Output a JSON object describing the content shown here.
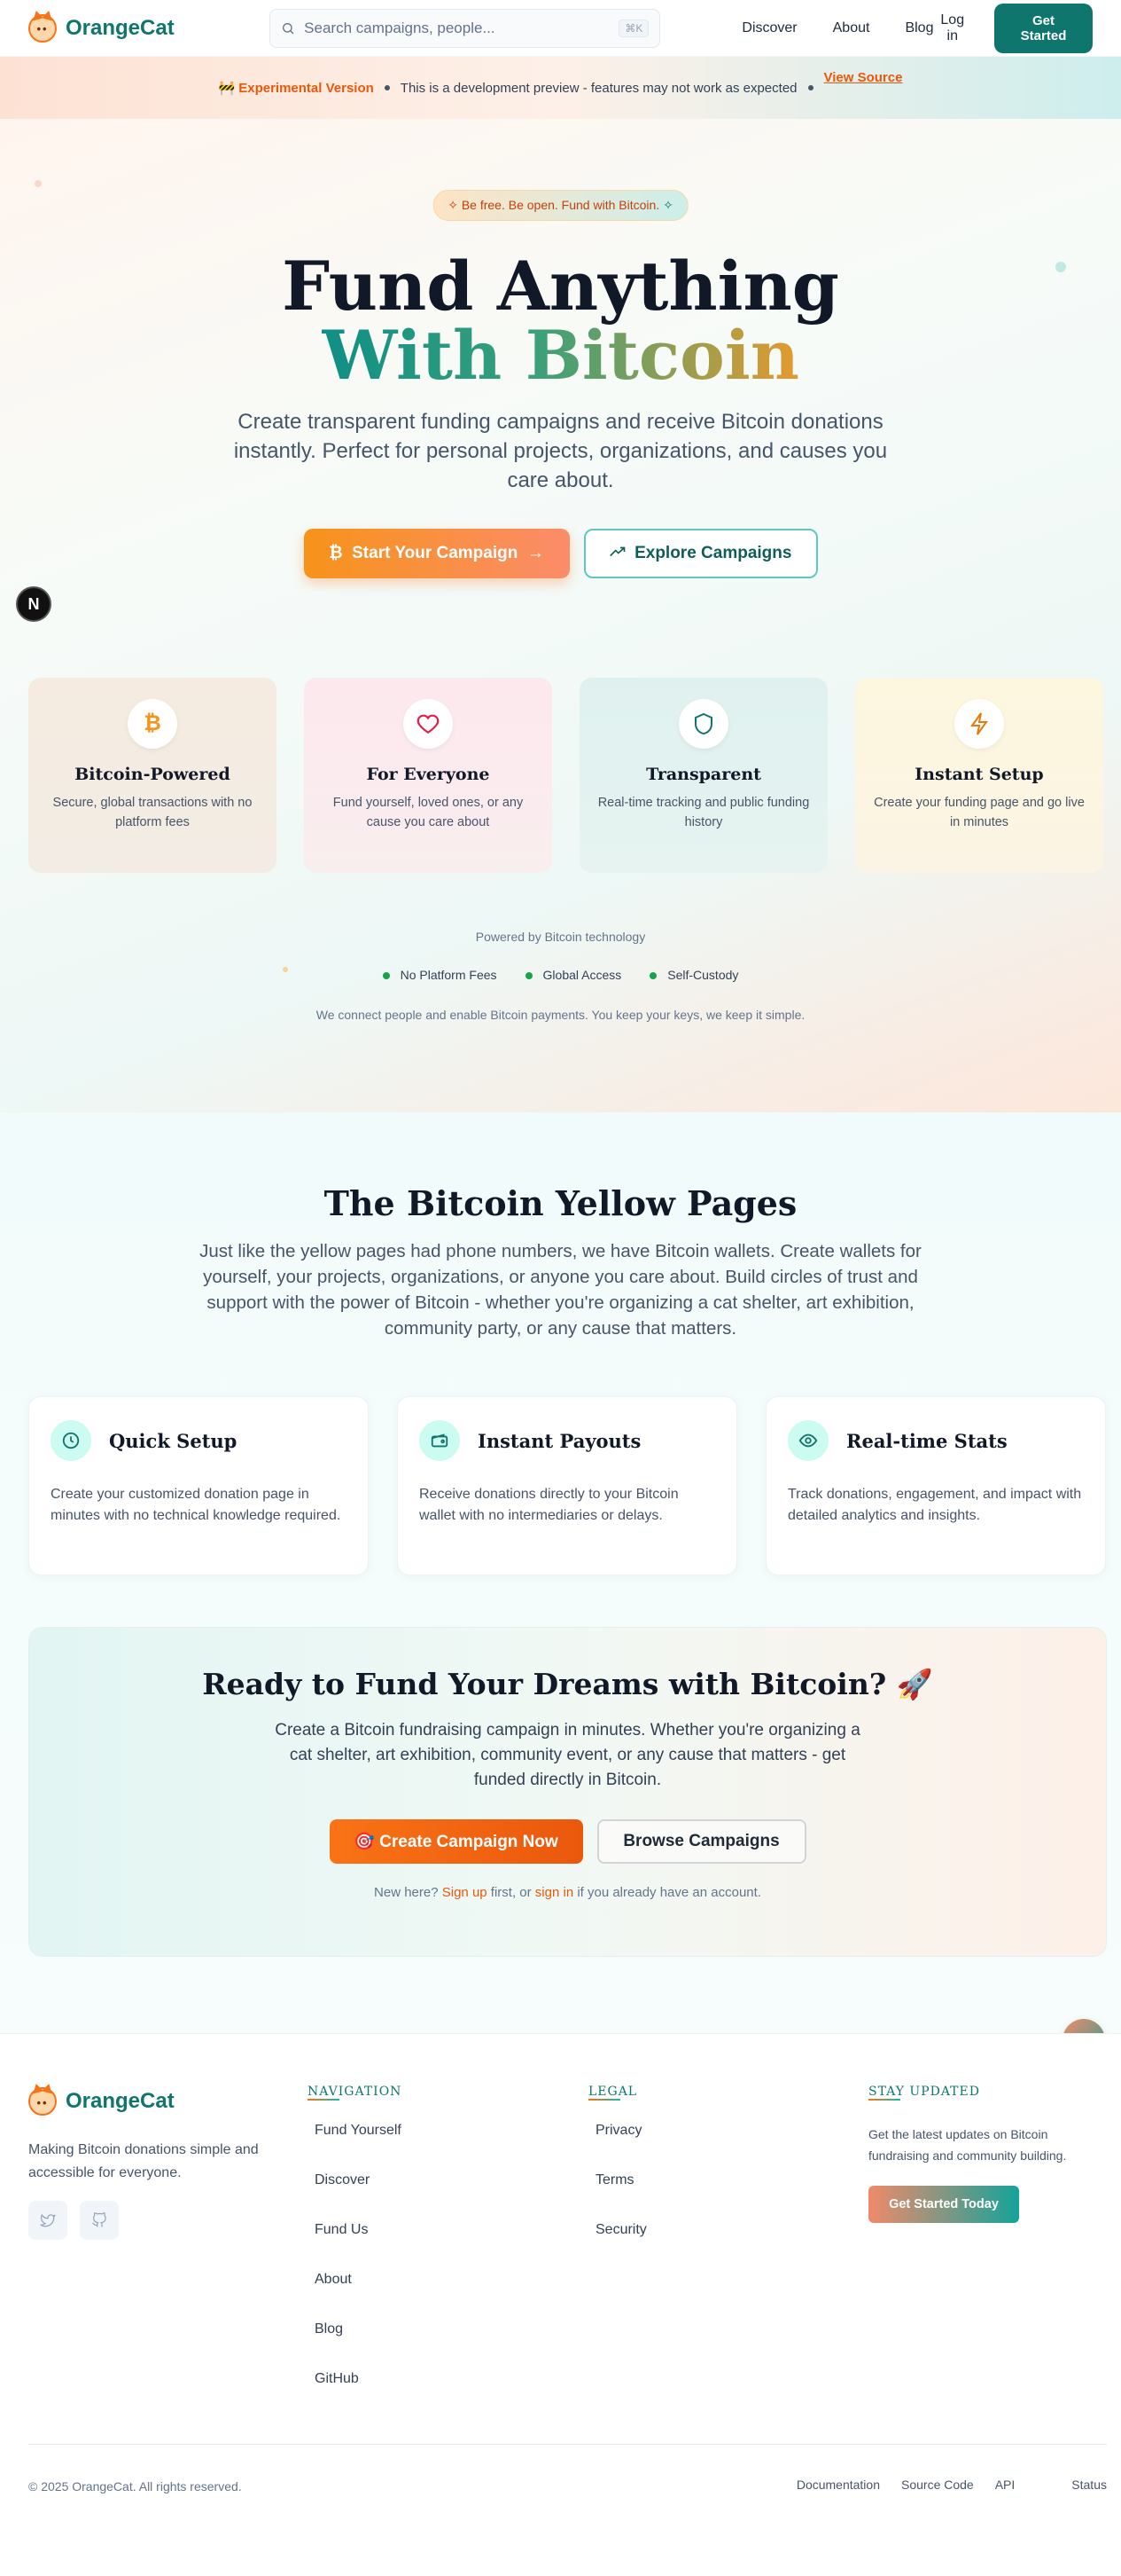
{
  "header": {
    "brand": "OrangeCat",
    "search_placeholder": "Search campaigns, people...",
    "shortcut": "⌘K",
    "nav": [
      "Discover",
      "About",
      "Blog"
    ],
    "login": "Log in",
    "cta": "Get Started"
  },
  "banner": {
    "icon": "🚧",
    "label": "Experimental Version",
    "message": "This is a development preview - features may not work as expected",
    "link": "View Source"
  },
  "hero": {
    "pill": "Be free. Be open. Fund with Bitcoin.",
    "title_line1": "Fund Anything",
    "title_line2": "With Bitcoin",
    "lead": "Create transparent funding campaigns and receive Bitcoin donations instantly. Perfect for personal projects, organizations, and causes you care about.",
    "primary_button": "Start Your Campaign",
    "secondary_button": "Explore Campaigns",
    "badge": "N",
    "features": [
      {
        "title": "Bitcoin-Powered",
        "desc": "Secure, global transactions with no platform fees",
        "icon": "bitcoin-icon"
      },
      {
        "title": "For Everyone",
        "desc": "Fund yourself, loved ones, or any cause you care about",
        "icon": "heart-icon"
      },
      {
        "title": "Transparent",
        "desc": "Real-time tracking and public funding history",
        "icon": "shield-icon"
      },
      {
        "title": "Instant Setup",
        "desc": "Create your funding page and go live in minutes",
        "icon": "lightning-icon"
      }
    ],
    "powered": "Powered by Bitcoin technology",
    "bullets": [
      "No Platform Fees",
      "Global Access",
      "Self-Custody"
    ],
    "tagline": "We connect people and enable Bitcoin payments. You keep your keys, we keep it simple."
  },
  "yellow": {
    "title": "The Bitcoin Yellow Pages",
    "intro": "Just like the yellow pages had phone numbers, we have Bitcoin wallets. Create wallets for yourself, your projects, organizations, or anyone you care about. Build circles of trust and support with the power of Bitcoin - whether you're organizing a cat shelter, art exhibition, community party, or any cause that matters.",
    "cards": [
      {
        "title": "Quick Setup",
        "desc": "Create your customized donation page in minutes with no technical knowledge required.",
        "icon": "clock-icon"
      },
      {
        "title": "Instant Payouts",
        "desc": "Receive donations directly to your Bitcoin wallet with no intermediaries or delays.",
        "icon": "wallet-icon"
      },
      {
        "title": "Real-time Stats",
        "desc": "Track donations, engagement, and impact with detailed analytics and insights.",
        "icon": "eye-icon"
      }
    ]
  },
  "cta": {
    "title": "Ready to Fund Your Dreams with Bitcoin? 🚀",
    "desc": "Create a Bitcoin fundraising campaign in minutes. Whether you're organizing a cat shelter, art exhibition, community event, or any cause that matters - get funded directly in Bitcoin.",
    "primary": "🎯 Create Campaign Now",
    "secondary": "Browse Campaigns",
    "note_prefix": "New here? ",
    "signup": "Sign up",
    "note_mid": " first, or ",
    "signin": "sign in",
    "note_suffix": " if you already have an account."
  },
  "footer": {
    "brand": "OrangeCat",
    "desc": "Making Bitcoin donations simple and accessible for everyone.",
    "nav_title": "NAVIGATION",
    "nav_links": [
      "Fund Yourself",
      "Discover",
      "Fund Us",
      "About",
      "Blog",
      "GitHub"
    ],
    "legal_title": "LEGAL",
    "legal_links": [
      "Privacy",
      "Terms",
      "Security"
    ],
    "news_title": "STAY UPDATED",
    "news_desc": "Get the latest updates on Bitcoin fundraising and community building.",
    "news_button": "Get Started Today",
    "copyright": "© 2025 OrangeCat. All rights reserved.",
    "bottom_links": [
      "Documentation",
      "Source Code",
      "API",
      "Status"
    ]
  }
}
